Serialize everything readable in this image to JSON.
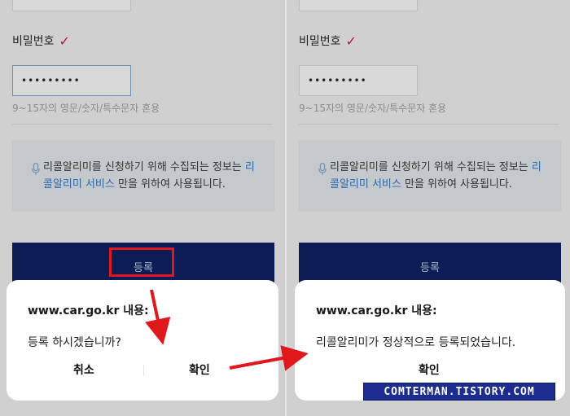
{
  "form": {
    "pw_label": "비밀번호",
    "pw_value": "•••••••••",
    "pw_hint": "9~15자의 영문/숫자/특수문자 혼용"
  },
  "notice": {
    "line_before_accent": "리콜알리미를 신청하기 위해 수집되는 정보는 ",
    "accent_part1": "리",
    "accent_part2": "콜알리미 서비스",
    "line_after_accent": " 만을 위하여 사용됩니다."
  },
  "register_button": "등록",
  "confirm_dialog": {
    "title": "www.car.go.kr 내용:",
    "message": "등록 하시겠습니까?",
    "cancel_label": "취소",
    "ok_label": "확인"
  },
  "result_dialog": {
    "title": "www.car.go.kr 내용:",
    "message": "리콜알리미가 정상적으로 등록되었습니다.",
    "ok_label": "확인"
  },
  "watermark": "COMTERMAN.TISTORY.COM",
  "colors": {
    "accent": "#2f67a8",
    "register_bar": "#0c1d55",
    "check_mark": "#b0182b",
    "callout_red": "#e1181b",
    "watermark_bg": "#1d2d8f"
  },
  "icons": {
    "check": "checkmark-icon",
    "mic": "microphone-icon",
    "arrow": "red-arrow"
  }
}
